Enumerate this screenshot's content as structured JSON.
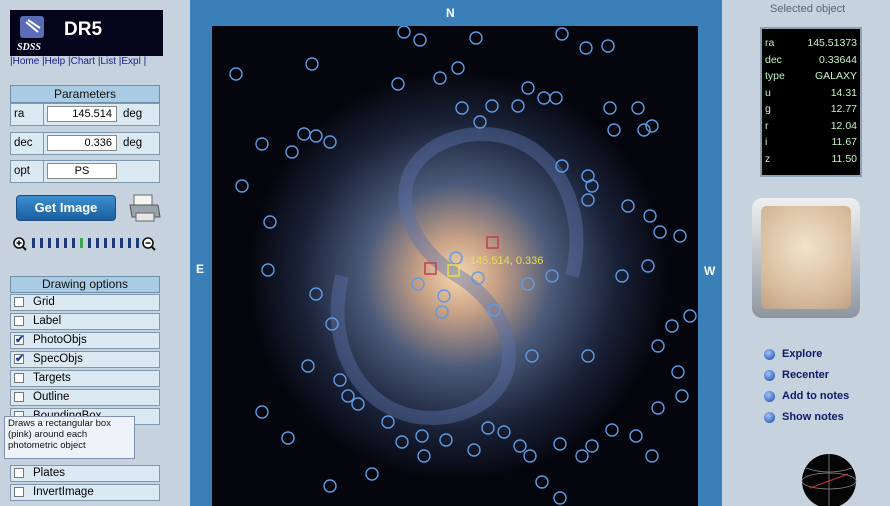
{
  "app": {
    "logo_text": "SDSS",
    "release": "DR5"
  },
  "nav": {
    "links": "|Home |Help |Chart |List |Expl |"
  },
  "params": {
    "title": "Parameters",
    "rows": [
      {
        "label": "ra",
        "value": "145.514",
        "unit": "deg"
      },
      {
        "label": "dec",
        "value": "0.336",
        "unit": "deg"
      },
      {
        "label": "opt",
        "value": "PS",
        "unit": ""
      }
    ]
  },
  "get_image_label": "Get Image",
  "drawing": {
    "title": "Drawing options",
    "options": [
      {
        "label": "Grid",
        "checked": false
      },
      {
        "label": "Label",
        "checked": false
      },
      {
        "label": "PhotoObjs",
        "checked": true
      },
      {
        "label": "SpecObjs",
        "checked": true
      },
      {
        "label": "Targets",
        "checked": false
      },
      {
        "label": "Outline",
        "checked": false
      },
      {
        "label": "BoundingBox",
        "checked": false
      },
      {
        "label": "Plates",
        "checked": false
      },
      {
        "label": "InvertImage",
        "checked": false
      }
    ]
  },
  "tooltip": "Draws a rectangular box (pink) around each photometric object",
  "compass": {
    "n": "N",
    "e": "E",
    "w": "W"
  },
  "image_label": "145.514, 0.336",
  "selected": {
    "title": "Selected object",
    "rows": [
      {
        "k": "ra",
        "v": "145.51373"
      },
      {
        "k": "dec",
        "v": "0.33644"
      },
      {
        "k": "type",
        "v": "GALAXY"
      },
      {
        "k": "u",
        "v": "14.31"
      },
      {
        "k": "g",
        "v": "12.77"
      },
      {
        "k": "r",
        "v": "12.04"
      },
      {
        "k": "i",
        "v": "11.67"
      },
      {
        "k": "z",
        "v": "11.50"
      }
    ]
  },
  "actions": [
    "Explore",
    "Recenter",
    "Add to notes",
    "Show notes"
  ],
  "colors": {
    "panel": "#c6d2de",
    "header": "#a9cbe3",
    "frame": "#3b7fb9",
    "marker": "#e8e04a"
  },
  "icons": [
    "printer-icon",
    "zoom-in-icon",
    "zoom-out-icon",
    "globe-icon"
  ]
}
